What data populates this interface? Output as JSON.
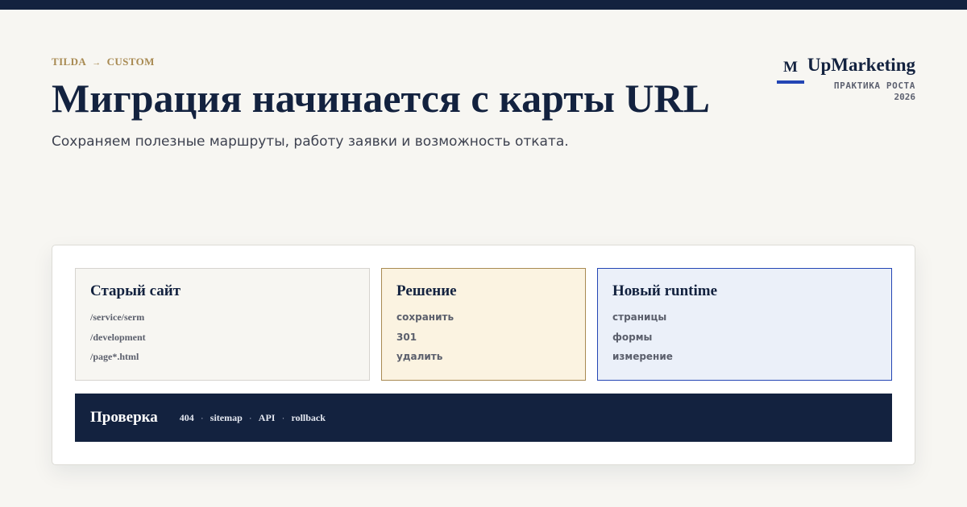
{
  "header": {
    "eyebrow_from": "TILDA",
    "eyebrow_arrow": "→",
    "eyebrow_to": "CUSTOM",
    "title": "Миграция начинается с карты URL",
    "subtitle": "Сохраняем полезные маршруты, работу заявки и возможность отката."
  },
  "brand": {
    "mark": "M",
    "name": "UpMarketing",
    "tagline": "ПРАКТИКА РОСТА",
    "year": "2026"
  },
  "columns": [
    {
      "title": "Старый сайт",
      "items": [
        "/service/serm",
        "/development",
        "/page*.html"
      ]
    },
    {
      "title": "Решение",
      "items": [
        "сохранить",
        "301",
        "удалить"
      ]
    },
    {
      "title": "Новый runtime",
      "items": [
        "страницы",
        "формы",
        "измерение"
      ]
    }
  ],
  "verify": {
    "title": "Проверка",
    "separator": "·",
    "items": [
      "404",
      "sitemap",
      "API",
      "rollback"
    ]
  },
  "colors": {
    "navy": "#13223f",
    "gold": "#a88a52",
    "blue": "#2345b4",
    "background": "#f7f6f2"
  }
}
